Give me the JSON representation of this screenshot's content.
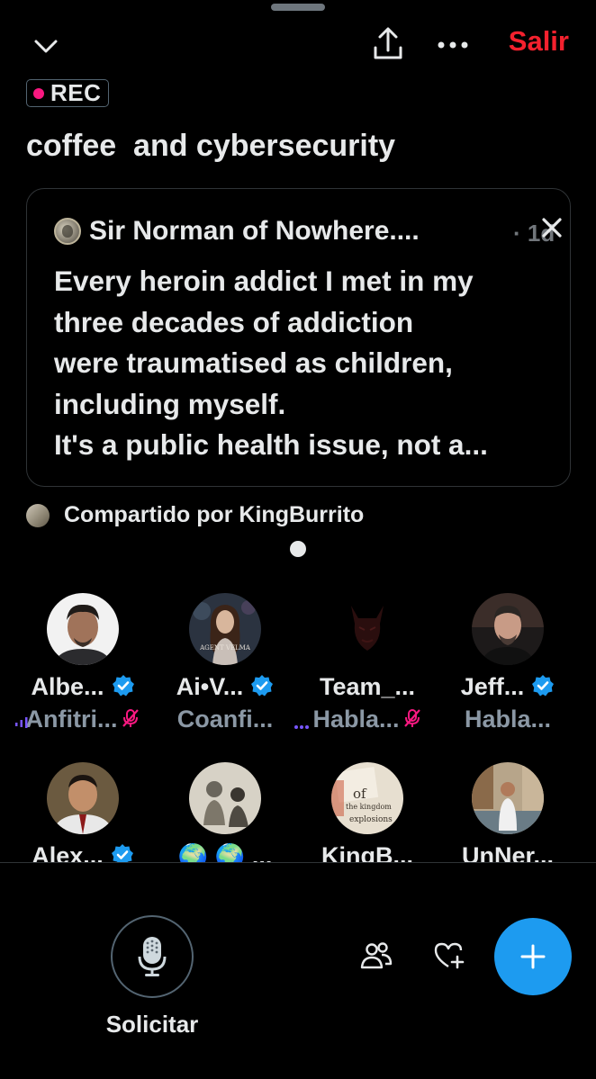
{
  "header": {
    "leave_label": "Salir",
    "rec_label": "REC",
    "icons": [
      "chevron-down-icon",
      "share-icon",
      "more-icon"
    ]
  },
  "space": {
    "title": "coffee  and cybersecurity"
  },
  "pinned_post": {
    "author": "Sir Norman of Nowhere....",
    "age": "· 1d",
    "lines": [
      "Every heroin addict I met in my",
      "three decades of addiction",
      "were traumatised as children,",
      "including myself.",
      "It's a public health issue, not a..."
    ]
  },
  "shared_by": "Compartido por KingBurrito",
  "participants": [
    {
      "name": "Albe...",
      "role": "Anfitri...",
      "verified": true,
      "muted": true,
      "speaking": true
    },
    {
      "name": "Ai•V...",
      "role": "Coanfi...",
      "verified": true,
      "muted": false,
      "speaking": true
    },
    {
      "name": "Team_...",
      "role": "Habla...",
      "verified": false,
      "muted": true,
      "speaking": false
    },
    {
      "name": "Jeff...",
      "role": "Habla...",
      "verified": true,
      "muted": false,
      "speaking": false
    },
    {
      "name": "Alex...",
      "role": "",
      "verified": true,
      "muted": false,
      "speaking": false
    },
    {
      "name": "🌍 🌍 ...",
      "role": "",
      "verified": false,
      "muted": false,
      "speaking": false
    },
    {
      "name": "KingB...",
      "role": "",
      "verified": false,
      "muted": false,
      "speaking": false
    },
    {
      "name": "UnNer...",
      "role": "",
      "verified": false,
      "muted": false,
      "speaking": false
    }
  ],
  "avatar_texts": {
    "ai_avatar": "AGENT VELMA",
    "kingburrito_avatar": [
      "of",
      "the kingdom",
      "explosions"
    ]
  },
  "footer": {
    "request_label": "Solicitar"
  },
  "colors": {
    "accent": "#1d9bf0",
    "leave": "#f4212e",
    "rec_dot": "#f91880",
    "muted_icon": "#f91880",
    "speaking": "#7856ff"
  }
}
